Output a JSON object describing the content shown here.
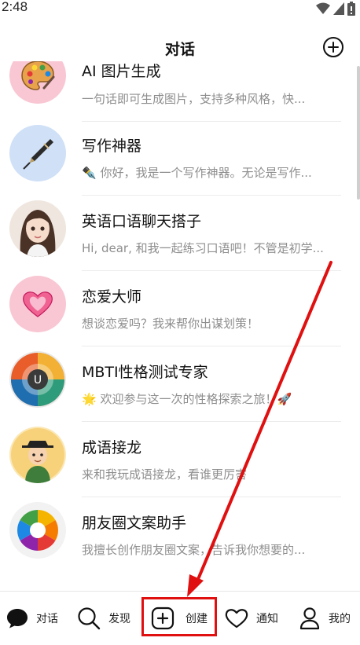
{
  "status_bar": {
    "time": "2:48"
  },
  "header": {
    "title": "对话",
    "add_icon": "plus-circle-icon"
  },
  "chats": [
    {
      "name": "AI 图片生成",
      "preview": "一句话即可生成图片，支持多种风格，快...",
      "avatar": "palette"
    },
    {
      "name": "写作神器",
      "preview": "✒️ 你好，我是一个写作神器。无论是写作...",
      "avatar": "fountain-pen"
    },
    {
      "name": "英语口语聊天搭子",
      "preview": "Hi, dear, 和我一起练习口语吧！不管是初学...",
      "avatar": "girl-portrait"
    },
    {
      "name": "恋爱大师",
      "preview": "想谈恋爱吗？我来帮你出谋划策！",
      "avatar": "pink-heart"
    },
    {
      "name": "MBTI性格测试专家",
      "preview": "🌟 欢迎参与这一次的性格探索之旅！🚀",
      "avatar": "mbti-wheel"
    },
    {
      "name": "成语接龙",
      "preview": "来和我玩成语接龙，看谁更厉害",
      "avatar": "scholar"
    },
    {
      "name": "朋友圈文案助手",
      "preview": "我擅长创作朋友圈文案，告诉我你想要的...",
      "avatar": "camera-aperture"
    }
  ],
  "tabs": [
    {
      "label": "对话",
      "icon": "chat-bubble-icon"
    },
    {
      "label": "发现",
      "icon": "search-icon"
    },
    {
      "label": "创建",
      "icon": "plus-square-icon"
    },
    {
      "label": "通知",
      "icon": "heart-icon"
    },
    {
      "label": "我的",
      "icon": "person-icon"
    }
  ],
  "colors": {
    "annotation_red": "#e01010",
    "avatar_pink": "#f9c7d4",
    "avatar_blue": "#cfe0f7"
  }
}
